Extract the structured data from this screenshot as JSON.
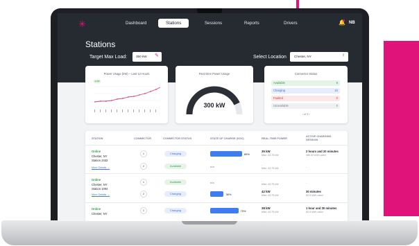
{
  "nav": {
    "items": [
      "Dashboard",
      "Stations",
      "Sessions",
      "Reports",
      "Drivers"
    ],
    "active": "Stations",
    "user": "NB"
  },
  "page": {
    "title": "Stations",
    "target_label": "Target Max Load:",
    "target_value": "350 kW",
    "location_label": "Select Location",
    "location_value": "Chester, NY"
  },
  "cards": {
    "usage_title": "Power Usage (kW) – Last 12 Hours",
    "usage_legend": "kW",
    "realtime_title": "Real-time Power Usage",
    "gauge_value": "300 kW",
    "gauge_level_fraction": 0.86,
    "connector_title": "Connector Status",
    "statuses": [
      {
        "label": "Available",
        "count": "8",
        "color": "#2f9f48",
        "bg": "#e6f4e8"
      },
      {
        "label": "Charging",
        "count": "10",
        "color": "#3f6fd9",
        "bg": "#e6eefb"
      },
      {
        "label": "Faulted",
        "count": "0",
        "color": "#d23c3c",
        "bg": "#fbe7e7"
      },
      {
        "label": "Unavailable",
        "count": "0",
        "color": "#7a8090",
        "bg": "#eef0f2"
      }
    ],
    "pager": "‹  of 3  ›"
  },
  "table": {
    "headers": [
      "STATION",
      "CONNECTOR",
      "CONNECTOR STATUS",
      "STATE OF CHARGE (SOC)",
      "REAL-TIME POWER",
      "ACTIVE CHARGING SESSION"
    ],
    "stations": [
      {
        "status": "Online",
        "city": "Chester, NY",
        "name": "Station 2432",
        "link": "More Details →",
        "connectors": [
          {
            "num": "1",
            "state": "Charging",
            "soc": "85%",
            "soc_fraction": 0.85,
            "power": "35 kW",
            "max": "Max: 43.75 kW",
            "session": "2 hours and 20 minutes",
            "used": "180.52 kWh used"
          },
          {
            "num": "2",
            "state": "Available",
            "soc": "n/a",
            "soc_fraction": 0,
            "power": "-",
            "max": "Max: 43.75 kW",
            "session": "-",
            "used": ""
          }
        ]
      },
      {
        "status": "Online",
        "city": "Chester, NY",
        "name": "Station 1004",
        "link": "More Details →",
        "connectors": [
          {
            "num": "1",
            "state": "Available",
            "soc": "n/a",
            "soc_fraction": 0,
            "power": "-",
            "max": "Max: 43.75 kW",
            "session": "-",
            "used": ""
          },
          {
            "num": "2",
            "state": "Charging",
            "soc": "36%",
            "soc_fraction": 0.36,
            "power": "42 kW",
            "max": "Max: 43.75 kW",
            "session": "30 minutes",
            "used": "52.5 kWh used"
          }
        ]
      },
      {
        "status": "Online",
        "city": "Chester, NY",
        "name": "",
        "link": "",
        "connectors": [
          {
            "num": "1",
            "state": "Charging",
            "soc": "75%",
            "soc_fraction": 0.75,
            "power": "38 kW",
            "max": "Max: 43.75 kW",
            "session": "1 hour and 30 minutes",
            "used": "52.5 kWh used"
          }
        ]
      }
    ]
  },
  "colors": {
    "accent": "#e0137a",
    "header_bg": "#262a31",
    "soc_bar": "#3f7cf0"
  }
}
